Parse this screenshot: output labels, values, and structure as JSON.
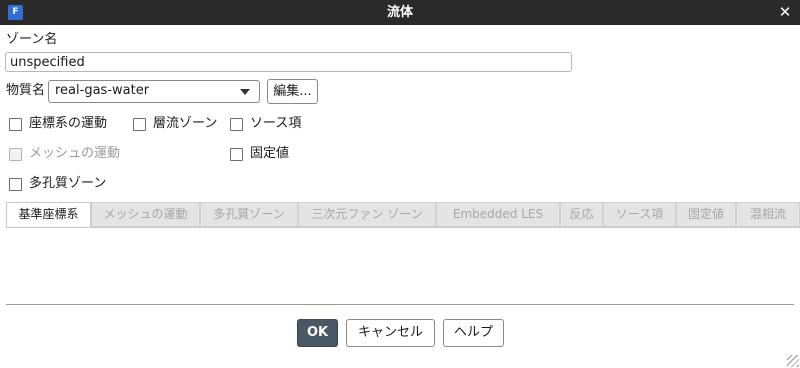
{
  "window": {
    "title": "流体",
    "app_icon": "F",
    "close": "✕"
  },
  "zone": {
    "label": "ゾーン名",
    "value": "unspecified"
  },
  "material": {
    "label": "物質名",
    "selected": "real-gas-water",
    "edit_button": "編集..."
  },
  "options": {
    "laminar_zone": "層流ゾーン",
    "source_terms": "ソース項",
    "mesh_motion": "メッシュの運動",
    "fixed_values": "固定値",
    "frame_motion": "座標系の運動",
    "porous_zone": "多孔質ゾーン"
  },
  "tabs": [
    {
      "label": "基準座標系",
      "active": true
    },
    {
      "label": "メッシュの運動",
      "active": false
    },
    {
      "label": "多孔質ゾーン",
      "active": false
    },
    {
      "label": "三次元ファン ゾーン",
      "active": false
    },
    {
      "label": "Embedded LES",
      "active": false
    },
    {
      "label": "反応",
      "active": false
    },
    {
      "label": "ソース項",
      "active": false
    },
    {
      "label": "固定値",
      "active": false
    },
    {
      "label": "混相流",
      "active": false
    }
  ],
  "buttons": {
    "ok": "OK",
    "cancel": "キャンセル",
    "help": "ヘルプ"
  },
  "colors": {
    "titlebar": "#2a2a2a",
    "ok_button": "#4a5764",
    "app_icon": "#2f6fd6"
  }
}
